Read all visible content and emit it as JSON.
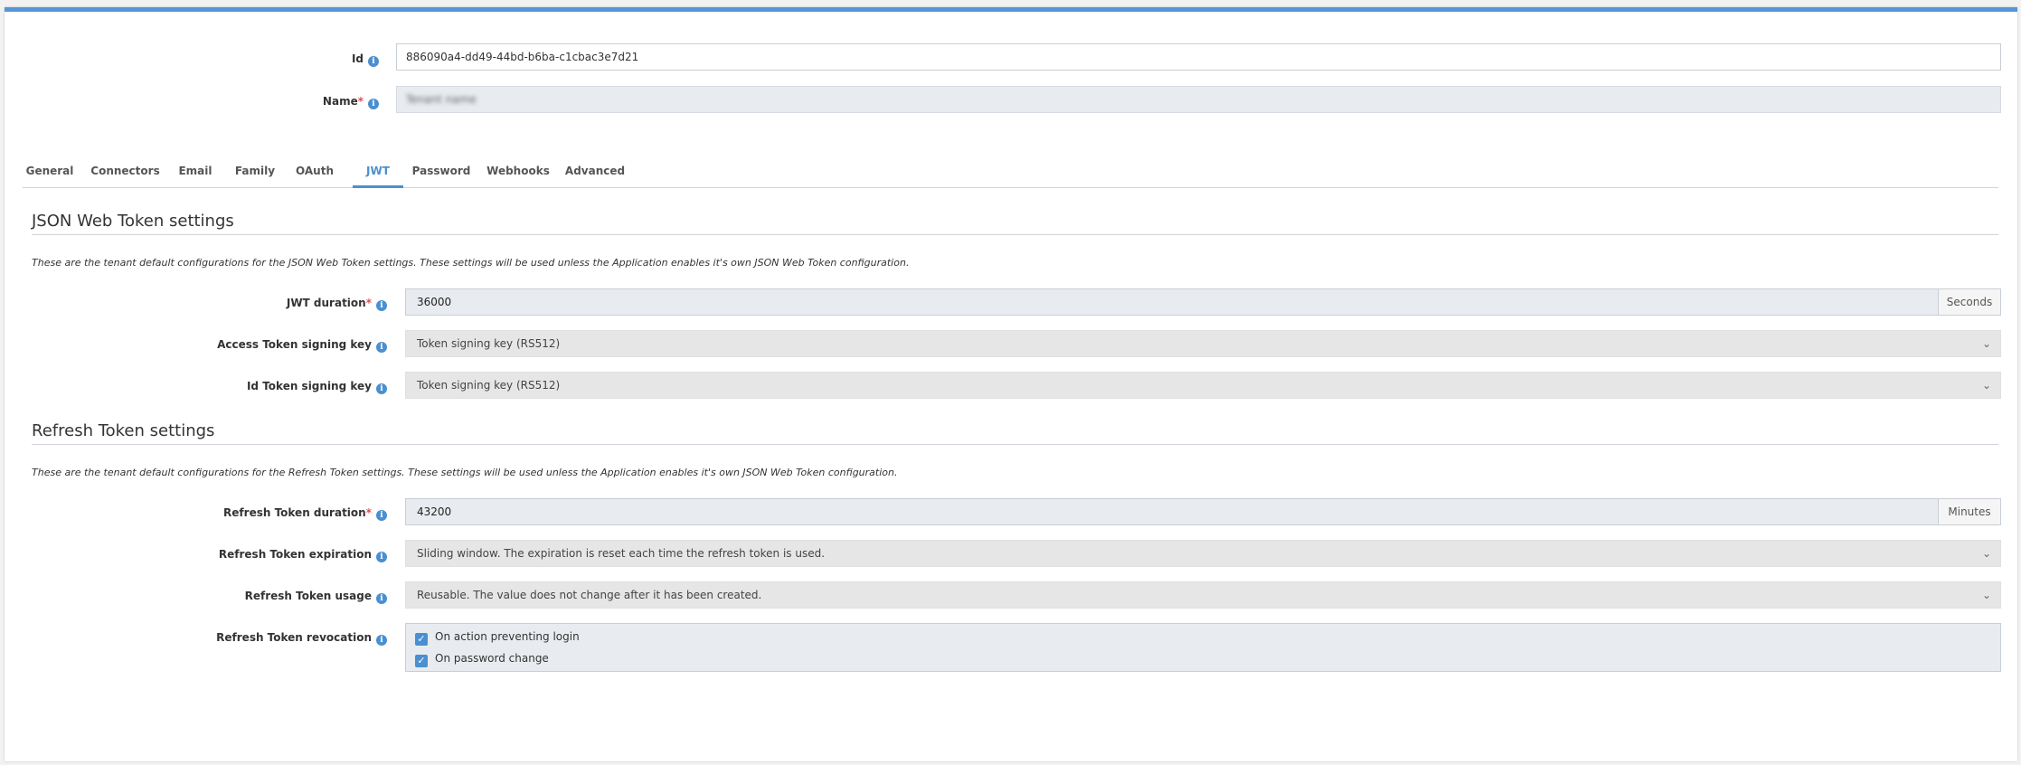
{
  "form": {
    "id_label": "Id",
    "id_value": "886090a4-dd49-44bd-b6ba-c1cbac3e7d21",
    "name_label": "Name",
    "name_value": "Tenant name",
    "required_mark": "*"
  },
  "tabs": [
    {
      "label": "General"
    },
    {
      "label": "Connectors"
    },
    {
      "label": "Email"
    },
    {
      "label": "Family"
    },
    {
      "label": "OAuth"
    },
    {
      "label": "JWT",
      "active": true
    },
    {
      "label": "Password"
    },
    {
      "label": "Webhooks"
    },
    {
      "label": "Advanced"
    }
  ],
  "jwt": {
    "title": "JSON Web Token settings",
    "description": "These are the tenant default configurations for the JSON Web Token settings. These settings will be used unless the Application enables it's own JSON Web Token configuration.",
    "duration_label": "JWT duration",
    "duration_value": "36000",
    "duration_unit": "Seconds",
    "access_key_label": "Access Token signing key",
    "access_key_value": "Token signing key (RS512)",
    "id_key_label": "Id Token signing key",
    "id_key_value": "Token signing key (RS512)"
  },
  "refresh": {
    "title": "Refresh Token settings",
    "description": "These are the tenant default configurations for the Refresh Token settings. These settings will be used unless the Application enables it's own JSON Web Token configuration.",
    "duration_label": "Refresh Token duration",
    "duration_value": "43200",
    "duration_unit": "Minutes",
    "expiration_label": "Refresh Token expiration",
    "expiration_value": "Sliding window. The expiration is reset each time the refresh token is used.",
    "usage_label": "Refresh Token usage",
    "usage_value": "Reusable. The value does not change after it has been created.",
    "revocation_label": "Refresh Token revocation",
    "revocation_options": [
      {
        "label": "On action preventing login",
        "checked": true
      },
      {
        "label": "On password change",
        "checked": true
      }
    ]
  },
  "icons": {
    "info": "info-icon",
    "chevron": "chevron-down-icon",
    "check": "checkmark-icon"
  },
  "colors": {
    "accent": "#4a8fd0",
    "top_bar": "#5496d6",
    "required": "#d9534f"
  }
}
